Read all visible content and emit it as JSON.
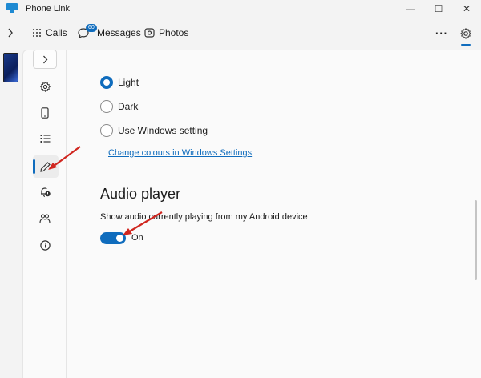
{
  "window": {
    "title": "Phone Link",
    "controls": {
      "minimize": "—",
      "maximize": "☐",
      "close": "✕"
    }
  },
  "nav": {
    "tabs": [
      {
        "label": "Calls",
        "icon": "dialpad-icon"
      },
      {
        "label": "Messages",
        "icon": "chat-icon",
        "badge": "60"
      },
      {
        "label": "Photos",
        "icon": "photos-icon"
      }
    ],
    "more": "···"
  },
  "sidebar": {
    "items": [
      {
        "icon": "gear-icon"
      },
      {
        "icon": "phone-icon"
      },
      {
        "icon": "list-icon"
      },
      {
        "icon": "pen-icon",
        "selected": true
      },
      {
        "icon": "bell-alert-icon"
      },
      {
        "icon": "people-icon"
      },
      {
        "icon": "info-icon"
      }
    ]
  },
  "theme": {
    "options": [
      {
        "label": "Light",
        "checked": true
      },
      {
        "label": "Dark",
        "checked": false
      },
      {
        "label": "Use Windows setting",
        "checked": false
      }
    ],
    "link": "Change colours in Windows Settings"
  },
  "audio_player": {
    "title": "Audio player",
    "description": "Show audio currently playing from my Android device",
    "toggle_on": true,
    "toggle_label": "On"
  },
  "colors": {
    "accent": "#0f6cbd",
    "arrow": "#d0261f"
  }
}
